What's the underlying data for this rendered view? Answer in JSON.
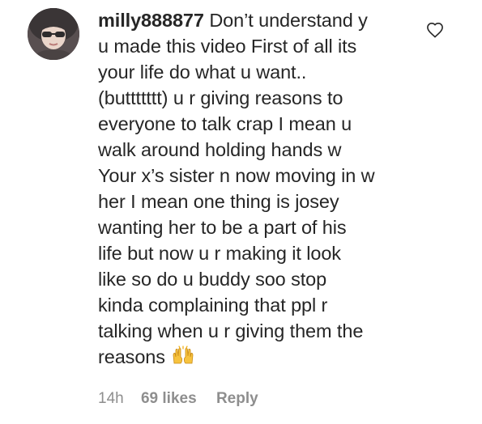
{
  "comment": {
    "username": "milly888877",
    "lines": [
      "Don’t understand y",
      "u made this video First of all its",
      "your life do what u want..",
      "(buttttttt) u r giving reasons to",
      "everyone to talk crap I mean u",
      "walk around holding hands w",
      "Your x’s sister n now moving in w",
      "her I mean one thing is josey",
      "wanting her to be a part of his",
      "life but now u r making it look",
      "like so do u buddy soo stop",
      "kinda complaining that ppl r",
      "talking when u r giving them the",
      "reasons"
    ],
    "emoji": "raising-hands"
  },
  "meta": {
    "time": "14h",
    "likes": "69 likes",
    "reply": "Reply"
  },
  "icons": {
    "like": "heart-outline-icon",
    "avatar": "profile-photo"
  },
  "colors": {
    "text": "#262626",
    "secondary": "#8e8e8e",
    "background": "#ffffff"
  }
}
